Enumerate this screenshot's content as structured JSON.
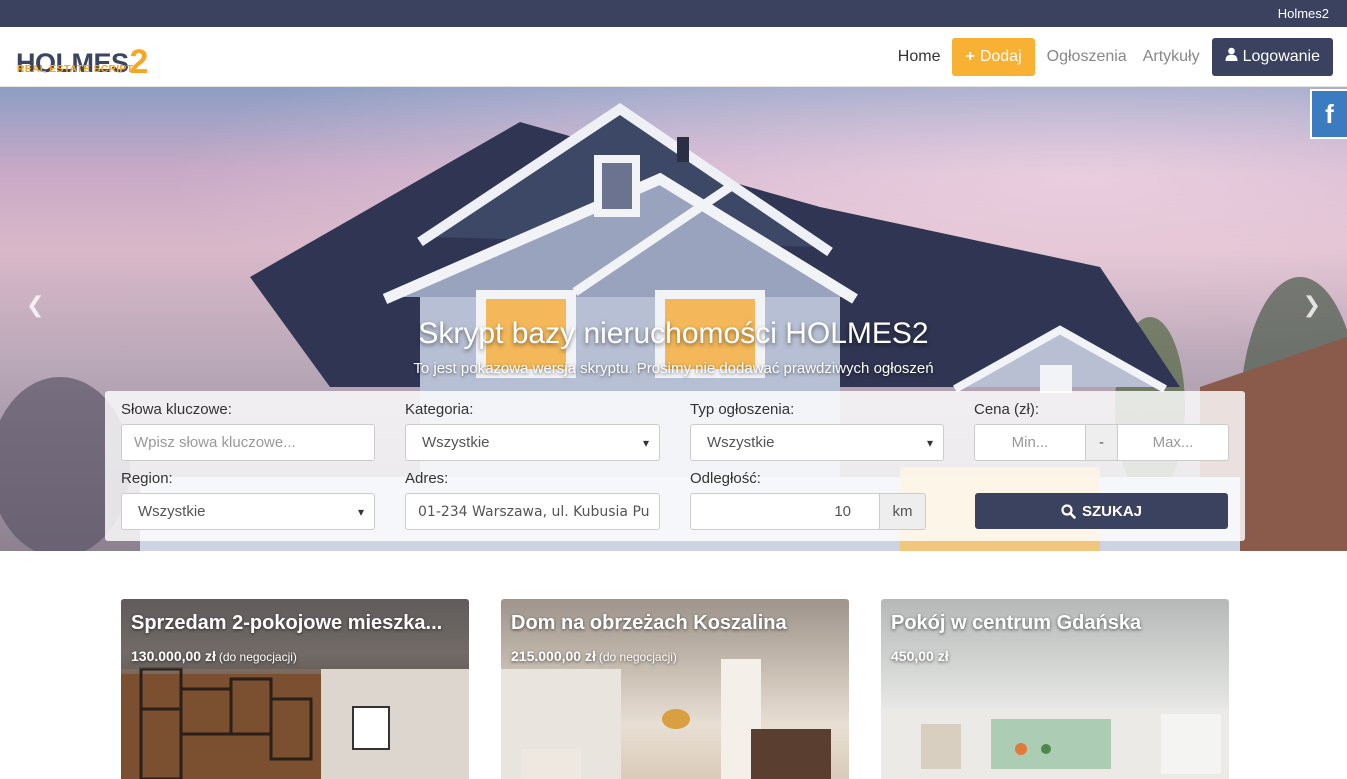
{
  "topbar": {
    "site_name": "Holmes2"
  },
  "brand": {
    "logo_main": "HOLMES",
    "logo_number": "2",
    "logo_sub": "REAL ESTATE SCRIPT"
  },
  "nav": {
    "home": "Home",
    "add": "Dodaj",
    "listings": "Ogłoszenia",
    "articles": "Artykuły",
    "login": "Logowanie"
  },
  "hero": {
    "title": "Skrypt bazy nieruchomości HOLMES2",
    "subtitle": "To jest pokazowa wersja skryptu. Prosimy nie dodawać prawdziwych ogłoszeń"
  },
  "social": {
    "facebook": "f"
  },
  "search": {
    "keywords_label": "Słowa kluczowe:",
    "keywords_placeholder": "Wpisz słowa kluczowe...",
    "category_label": "Kategoria:",
    "category_value": "Wszystkie",
    "type_label": "Typ ogłoszenia:",
    "type_value": "Wszystkie",
    "price_label": "Cena (zł):",
    "price_min_placeholder": "Min...",
    "price_sep": "-",
    "price_max_placeholder": "Max...",
    "region_label": "Region:",
    "region_value": "Wszystkie",
    "address_label": "Adres:",
    "address_value": "01-234 Warszawa, ul. Kubusia Pu",
    "distance_label": "Odległość:",
    "distance_value": "10",
    "distance_unit": "km",
    "submit": "SZUKAJ"
  },
  "listings": [
    {
      "title": "Sprzedam 2-pokojowe mieszka...",
      "price": "130.000,00 zł",
      "note": "(do negocjacji)"
    },
    {
      "title": "Dom na obrzeżach Koszalina",
      "price": "215.000,00 zł",
      "note": "(do negocjacji)"
    },
    {
      "title": "Pokój w centrum Gdańska",
      "price": "450,00 zł",
      "note": ""
    }
  ],
  "colors": {
    "navy": "#3a4260",
    "accent": "#f8b133",
    "facebook": "#3b7bbf"
  }
}
